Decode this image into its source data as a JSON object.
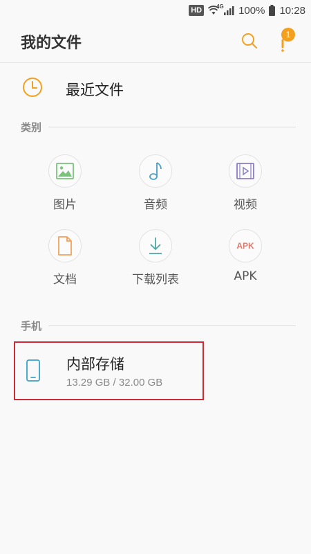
{
  "status_bar": {
    "hd": "HD",
    "network": "4G",
    "battery": "100%",
    "time": "10:28"
  },
  "app_bar": {
    "title": "我的文件",
    "notification_count": "1"
  },
  "recent": {
    "label": "最近文件"
  },
  "categories": {
    "header": "类别",
    "items": [
      {
        "label": "图片",
        "icon": "image-icon"
      },
      {
        "label": "音频",
        "icon": "music-note-icon"
      },
      {
        "label": "视频",
        "icon": "video-icon"
      },
      {
        "label": "文档",
        "icon": "document-icon"
      },
      {
        "label": "下载列表",
        "icon": "download-icon"
      },
      {
        "label": "APK",
        "icon": "apk-icon",
        "icon_text": "APK"
      }
    ]
  },
  "phone": {
    "header": "手机",
    "storage": {
      "name": "内部存储",
      "size": "13.29 GB / 32.00 GB"
    }
  },
  "colors": {
    "accent": "#f4a01f",
    "image": "#7bc27b",
    "audio": "#4a9ec4",
    "video": "#8a7cc4",
    "document": "#f2a25c",
    "download": "#4aa9a1",
    "apk": "#e07a6a",
    "storage": "#3aa3c8",
    "highlight": "#cc2a36"
  }
}
